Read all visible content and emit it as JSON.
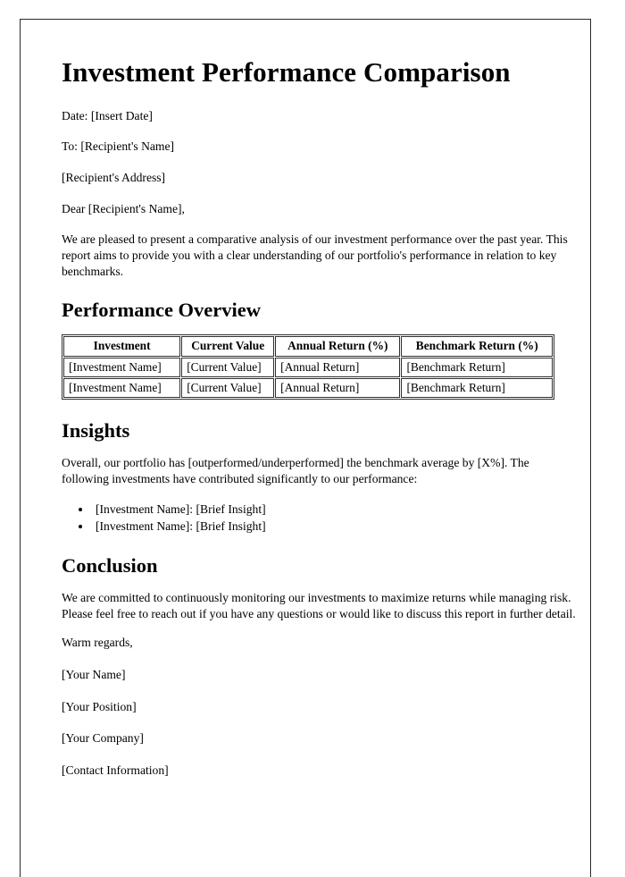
{
  "document": {
    "title": "Investment Performance Comparison",
    "header_lines": [
      "Date: [Insert Date]",
      "To: [Recipient's Name]",
      "[Recipient's Address]",
      "Dear [Recipient's Name],"
    ],
    "intro_paragraph": "We are pleased to present a comparative analysis of our investment performance over the past year. This report aims to provide you with a clear understanding of our portfolio's performance in relation to key benchmarks.",
    "performance_overview": {
      "heading": "Performance Overview",
      "table": {
        "columns": [
          "Investment",
          "Current Value",
          "Annual Return (%)",
          "Benchmark Return (%)"
        ],
        "rows": [
          [
            "[Investment Name]",
            "[Current Value]",
            "[Annual Return]",
            "[Benchmark Return]"
          ],
          [
            "[Investment Name]",
            "[Current Value]",
            "[Annual Return]",
            "[Benchmark Return]"
          ]
        ]
      }
    },
    "insights": {
      "heading": "Insights",
      "paragraph": "Overall, our portfolio has [outperformed/underperformed] the benchmark average by [X%]. The following investments have contributed significantly to our performance:",
      "bullets": [
        "[Investment Name]: [Brief Insight]",
        "[Investment Name]: [Brief Insight]"
      ]
    },
    "conclusion": {
      "heading": "Conclusion",
      "paragraph": "We are committed to continuously monitoring our investments to maximize returns while managing risk. Please feel free to reach out if you have any questions or would like to discuss this report in further detail."
    },
    "signoff": {
      "closing": "Warm regards,",
      "lines": [
        "[Your Name]",
        "[Your Position]",
        "[Your Company]",
        "[Contact Information]"
      ]
    }
  },
  "colors": {
    "text": "#000000",
    "page_border": "#2b2b2b",
    "table_border": "#303030",
    "background": "#ffffff"
  }
}
